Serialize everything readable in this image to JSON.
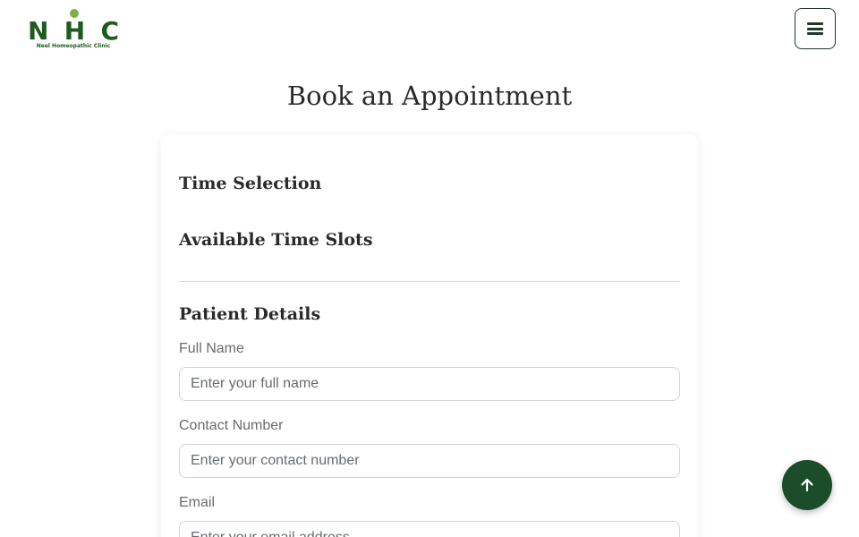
{
  "header": {
    "logo_text": [
      "N",
      "H",
      "C"
    ],
    "logo_subtitle": "Neel Homeopathic Clinic",
    "menu_icon": "hamburger-icon"
  },
  "page": {
    "title": "Book an Appointment"
  },
  "card": {
    "time_selection_title": "Time Selection",
    "available_slots_title": "Available Time Slots",
    "patient_details_title": "Patient Details",
    "fields": [
      {
        "label": "Full Name",
        "placeholder": "Enter your full name",
        "value": ""
      },
      {
        "label": "Contact Number",
        "placeholder": "Enter your contact number",
        "value": ""
      },
      {
        "label": "Email",
        "placeholder": "Enter your email address",
        "value": ""
      }
    ]
  },
  "back_to_top": {
    "icon": "arrow-up-icon"
  },
  "colors": {
    "brand_green": "#1e5b1e",
    "leaf_green": "#7cb342",
    "button_dark_green": "#1b4d2b"
  }
}
